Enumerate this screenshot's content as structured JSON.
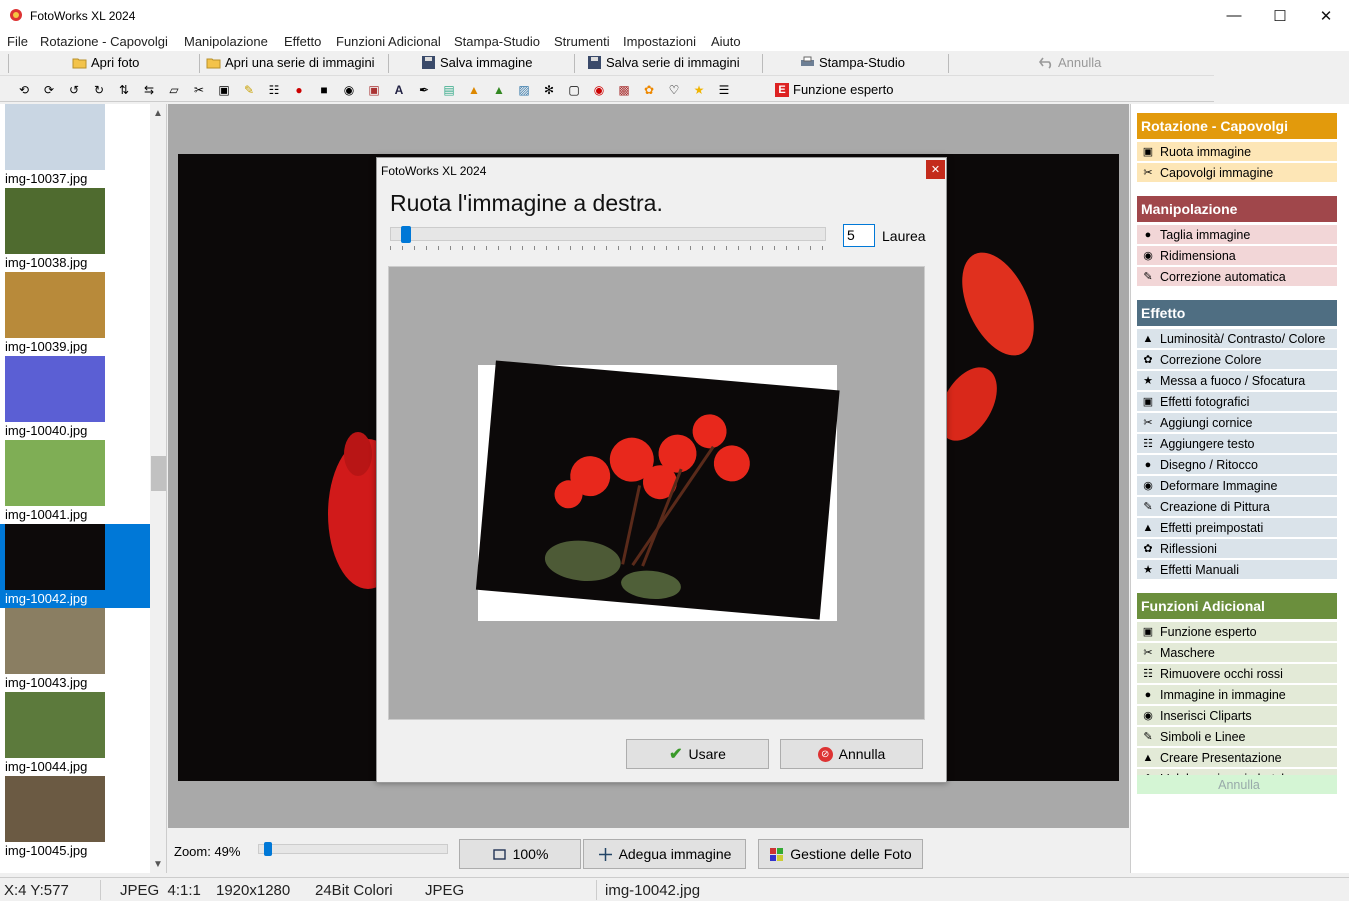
{
  "window": {
    "title": "FotoWorks XL 2024"
  },
  "menu": [
    "File",
    "Rotazione - Capovolgi",
    "Manipolazione",
    "Effetto",
    "Funzioni Adicional",
    "Stampa-Studio",
    "Strumenti",
    "Impostazioni",
    "Aiuto"
  ],
  "toolbar": {
    "open_photo": "Apri foto",
    "open_series": "Apri una serie di immagini",
    "save_image": "Salva immagine",
    "save_series": "Salva serie di immagini",
    "print_studio": "Stampa-Studio",
    "undo": "Annulla",
    "expert": "Funzione esperto"
  },
  "thumbnails": [
    {
      "name": "img-10037.jpg",
      "color": "#c9d6e3"
    },
    {
      "name": "img-10038.jpg",
      "color": "#4f6b2f"
    },
    {
      "name": "img-10039.jpg",
      "color": "#b88a3a"
    },
    {
      "name": "img-10040.jpg",
      "color": "#5b5fd4"
    },
    {
      "name": "img-10041.jpg",
      "color": "#7fae55"
    },
    {
      "name": "img-10042.jpg",
      "color": "#0d0a0a",
      "selected": true
    },
    {
      "name": "img-10043.jpg",
      "color": "#8a7e62"
    },
    {
      "name": "img-10044.jpg",
      "color": "#5c7a3c"
    },
    {
      "name": "img-10045.jpg",
      "color": "#6b5a43"
    }
  ],
  "zoom": {
    "label": "Zoom: 49%",
    "value_percent": 49,
    "btn_100": "100%",
    "btn_fit": "Adegua immagine",
    "btn_manager": "Gestione delle Foto"
  },
  "status": {
    "coords": "X:4 Y:577",
    "format": "JPEG  4:1:1",
    "size": "1920x1280",
    "depth": "24Bit Colori",
    "type": "JPEG",
    "file": "img-10042.jpg"
  },
  "panel": {
    "sections": [
      {
        "title": "Rotazione - Capovolgi",
        "header_color": "#e29a0c",
        "item_color": "#fde6b6",
        "items": [
          "Ruota immagine",
          "Capovolgi immagine"
        ]
      },
      {
        "title": "Manipolazione",
        "header_color": "#a0474b",
        "item_color": "#f2d6d7",
        "items": [
          "Taglia immagine",
          "Ridimensiona",
          "Correzione automatica"
        ]
      },
      {
        "title": "Effetto",
        "header_color": "#4f6e82",
        "item_color": "#dae3ea",
        "items": [
          "Luminosità/ Contrasto/ Colore",
          "Correzione Colore",
          "Messa a fuoco / Sfocatura",
          "Effetti fotografici",
          "Aggiungi cornice",
          "Aggiungere testo",
          "Disegno / Ritocco",
          "Deformare Immagine",
          "Creazione di Pittura",
          "Effetti preimpostati",
          "Riflessioni",
          "Effetti Manuali"
        ]
      },
      {
        "title": "Funzioni Adicional",
        "header_color": "#6b8f3d",
        "item_color": "#e3ead7",
        "items": [
          "Funzione esperto",
          "Maschere",
          "Rimuovere occhi rossi",
          "Immagine in immagine",
          "Inserisci Cliparts",
          "Simboli e Linee",
          "Creare Presentazione",
          "L'elaborazione in batch"
        ]
      }
    ],
    "undo": "Annulla"
  },
  "dialog": {
    "title": "FotoWorks XL 2024",
    "heading": "Ruota l'immagine a destra.",
    "angle_value": "5",
    "unit": "Laurea",
    "use": "Usare",
    "cancel": "Annulla",
    "slider_value": 5
  }
}
